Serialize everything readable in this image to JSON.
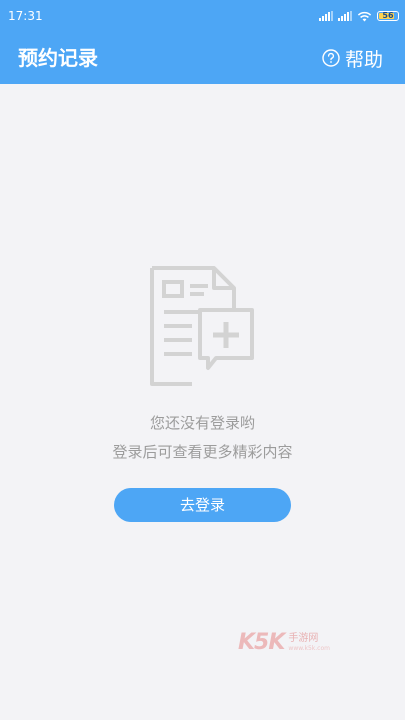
{
  "status_bar": {
    "time": "17:31",
    "battery_level": "56",
    "icons": [
      "signal-icon",
      "signal-icon",
      "wifi-icon",
      "battery-icon"
    ]
  },
  "header": {
    "title": "预约记录",
    "help_label": "帮助",
    "help_icon": "question-circle-icon"
  },
  "empty_state": {
    "icon": "document-plus-icon",
    "line1": "您还没有登录哟",
    "line2": "登录后可查看更多精彩内容",
    "login_button": "去登录"
  },
  "watermark": {
    "logo_text": "K5K",
    "sub_text": "手游网",
    "url": "www.k5k.com"
  },
  "colors": {
    "primary": "#4da6f5",
    "background": "#f3f3f6",
    "muted_text": "#9c9c9c",
    "icon_gray": "#d0d0d0"
  }
}
